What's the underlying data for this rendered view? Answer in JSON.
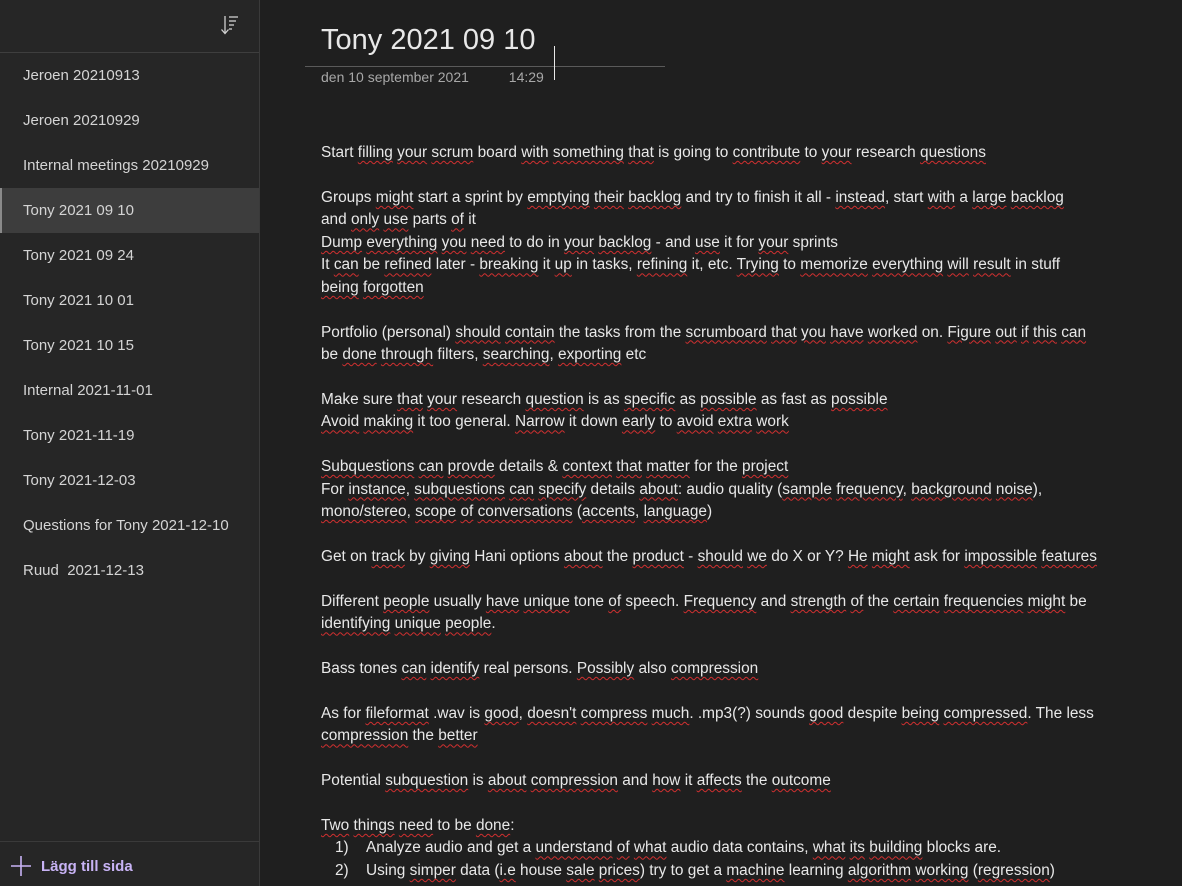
{
  "sidebar": {
    "sort_icon": "sort-descending-icon",
    "pages": [
      {
        "label": "Jeroen 20210913",
        "selected": false
      },
      {
        "label": "Jeroen 20210929",
        "selected": false
      },
      {
        "label": "Internal meetings 20210929",
        "selected": false
      },
      {
        "label": "Tony 2021 09 10",
        "selected": true
      },
      {
        "label": "Tony 2021 09 24",
        "selected": false
      },
      {
        "label": "Tony 2021 10 01",
        "selected": false
      },
      {
        "label": "Tony 2021 10 15",
        "selected": false
      },
      {
        "label": "Internal 2021-11-01",
        "selected": false
      },
      {
        "label": "Tony 2021-11-19",
        "selected": false
      },
      {
        "label": "Tony 2021-12-03",
        "selected": false
      },
      {
        "label": "Questions for Tony 2021-12-10",
        "selected": false
      },
      {
        "label": "Ruud  2021-12-13",
        "selected": false
      }
    ],
    "add_page_label": "Lägg till sida",
    "add_page_icon": "plus-icon",
    "accent_color": "#c8b3f5"
  },
  "page": {
    "title": "Tony 2021 09 10",
    "date": "den 10 september 2021",
    "time": "14:29"
  },
  "content": {
    "paragraphs": [
      [
        "Start filling your scrum board with something that is going to contribute to your research questions"
      ],
      [
        "Groups might start a sprint by emptying their backlog and try to finish it all - instead, start with a large backlog",
        "and only use parts of it",
        "Dump everything you need to do in your backlog - and use it for your sprints",
        "It can be refined later - breaking it up in tasks, refining it, etc. Trying to memorize everything will result in stuff",
        "being forgotten"
      ],
      [
        "Portfolio (personal) should contain the tasks from the scrumboard that you have worked on. Figure out if this can",
        "be done through filters, searching, exporting etc"
      ],
      [
        "Make sure that your research question is as specific as possible as fast as possible",
        "Avoid making it too general. Narrow it down early to avoid extra work"
      ],
      [
        "Subquestions can provde details & context that matter for the project",
        "For instance, subquestions can specify details about: audio quality (sample frequency, background noise),",
        "mono/stereo, scope of conversations (accents, language)"
      ],
      [
        "Get on track by giving Hani options about the product - should we do X or Y? He might ask for impossible features"
      ],
      [
        "Different people usually have unique tone of speech. Frequency and strength of the certain frequencies might be",
        "identifying unique people."
      ],
      [
        "Bass tones can identify real persons. Possibly also compression"
      ],
      [
        "As for fileformat .wav is good, doesn't compress much. .mp3(?) sounds good despite being compressed. The less",
        "compression the better"
      ],
      [
        "Potential subquestion is about compression and how it affects the outcome"
      ],
      [
        "Two things need to be done:"
      ]
    ],
    "list": [
      {
        "num": "1)",
        "text": "Analyze audio and get a understand of what audio data contains, what its building blocks are."
      },
      {
        "num": "2)",
        "text": "Using simper data (i.e house sale prices) try to get a machine learning algorithm working (regression)"
      }
    ]
  }
}
